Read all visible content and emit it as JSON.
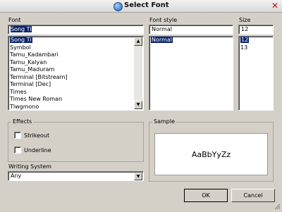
{
  "window": {
    "title": "Select Font",
    "close": "✕"
  },
  "font": {
    "label": "Font",
    "value": "Song Ti",
    "items": [
      "Song Ti",
      "Symbol",
      "Tamu_Kadambari",
      "Tamu_Kalyan",
      "Tamu_Maduram",
      "Terminal [Bitstream]",
      "Terminal [Dec]",
      "Times",
      "Times New Roman",
      "Tlwgmono"
    ],
    "selected_index": 0
  },
  "font_style": {
    "label": "Font style",
    "value": "Normal",
    "items": [
      "Normal"
    ],
    "selected_index": 0
  },
  "size": {
    "label": "Size",
    "value": "12",
    "items": [
      "12",
      "13"
    ],
    "selected_index": 0
  },
  "effects": {
    "label": "Effects",
    "strikeout": "Strikeout",
    "underline": "Underline"
  },
  "sample": {
    "label": "Sample",
    "text": "AaBbYyZz"
  },
  "writing_system": {
    "label": "Writing System",
    "value": "Any"
  },
  "buttons": {
    "ok": "OK",
    "cancel": "Cancel"
  },
  "colors": {
    "selection": "#0a246a",
    "dialog_bg": "#d4d0c8"
  }
}
